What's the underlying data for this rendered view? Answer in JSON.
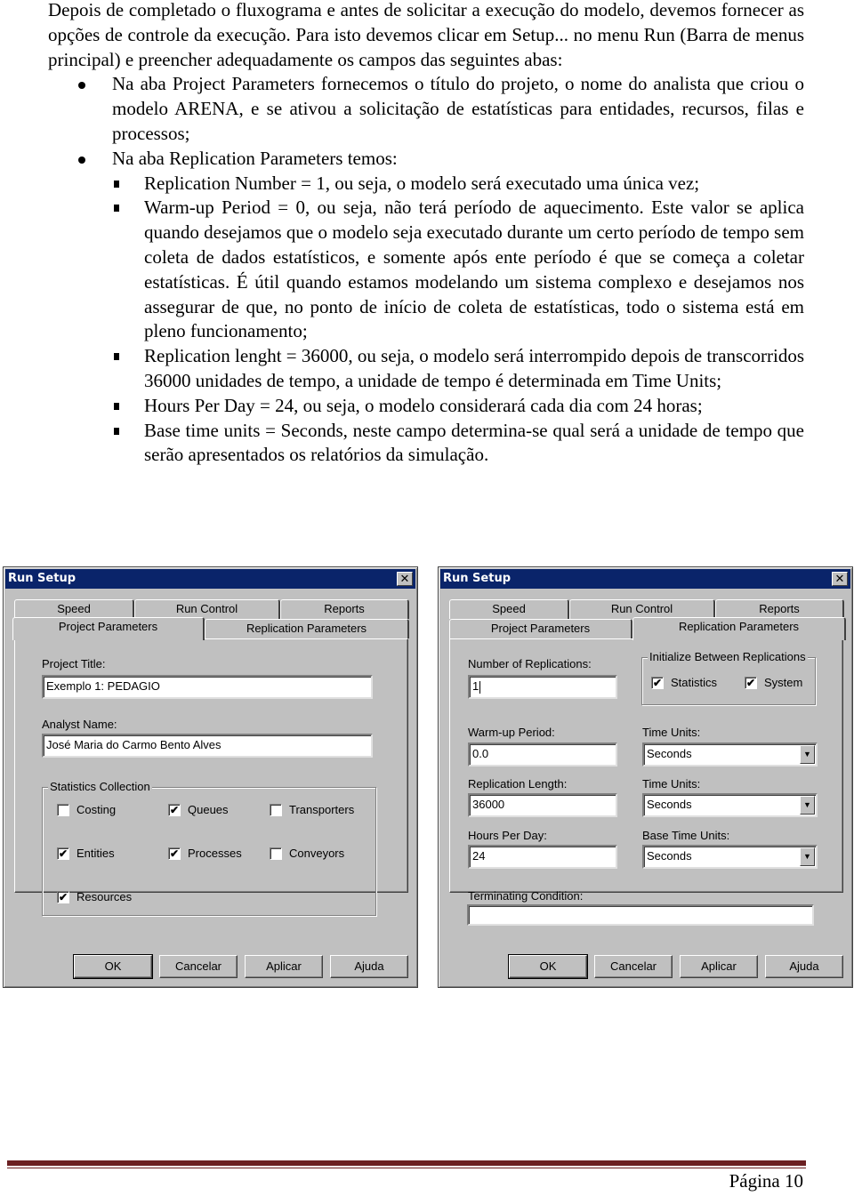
{
  "document": {
    "intro": "Depois de completado o fluxograma e antes de solicitar a execução do modelo, devemos fornecer as opções de controle da execução. Para isto devemos clicar em Setup... no menu Run (Barra de menus principal) e preencher adequadamente os campos das seguintes abas:",
    "bullets": [
      {
        "text": "Na aba Project Parameters fornecemos o título do projeto, o nome do analista que criou o modelo ARENA, e se ativou a solicitação de estatísticas para entidades, recursos, filas e processos;"
      },
      {
        "text": "Na aba Replication Parameters temos:"
      }
    ],
    "sub_bullets": [
      "Replication Number = 1, ou seja, o modelo será executado uma única vez;",
      "Warm-up Period = 0, ou seja, não terá período de aquecimento. Este valor se aplica quando desejamos que o modelo seja executado durante um certo período de tempo sem coleta de dados estatísticos, e somente após ente período é que se começa a coletar estatísticas. É útil quando estamos modelando um sistema complexo e desejamos nos assegurar de que, no ponto de início de coleta de estatísticas, todo o sistema está em pleno funcionamento;",
      "Replication lenght = 36000, ou seja, o modelo será interrompido depois de transcorridos 36000 unidades de tempo, a unidade de tempo é determinada em Time Units;",
      "Hours Per Day = 24, ou seja, o modelo considerará cada dia com 24 horas;",
      "Base time units = Seconds, neste campo determina-se qual será a unidade de tempo que serão apresentados os relatórios da simulação."
    ]
  },
  "dialog_common": {
    "title": "Run Setup",
    "close_glyph": "✕",
    "tabs": {
      "speed": "Speed",
      "run_control": "Run Control",
      "reports": "Reports",
      "project_parameters": "Project Parameters",
      "replication_parameters": "Replication Parameters"
    },
    "buttons": {
      "ok": "OK",
      "cancel": "Cancelar",
      "apply": "Aplicar",
      "help": "Ajuda"
    },
    "check_glyph": "✔",
    "dropdown_glyph": "▼"
  },
  "dialog_project": {
    "active_tab": "Project Parameters",
    "project_title_label": "Project Title:",
    "project_title_value": "Exemplo 1: PEDAGIO",
    "analyst_name_label": "Analyst Name:",
    "analyst_name_value": "José Maria do Carmo Bento Alves",
    "stats_group_label": "Statistics Collection",
    "stats": [
      {
        "label": "Costing",
        "checked": false
      },
      {
        "label": "Queues",
        "checked": true
      },
      {
        "label": "Transporters",
        "checked": false
      },
      {
        "label": "Entities",
        "checked": true
      },
      {
        "label": "Processes",
        "checked": true
      },
      {
        "label": "Conveyors",
        "checked": false
      },
      {
        "label": "Resources",
        "checked": true
      }
    ]
  },
  "dialog_replication": {
    "active_tab": "Replication Parameters",
    "num_replications_label": "Number of Replications:",
    "num_replications_value": "1",
    "init_group_label": "Initialize Between Replications",
    "init_options": [
      {
        "label": "Statistics",
        "checked": true
      },
      {
        "label": "System",
        "checked": true
      }
    ],
    "warmup_label": "Warm-up Period:",
    "warmup_value": "0.0",
    "warmup_units_label": "Time Units:",
    "warmup_units_value": "Seconds",
    "rep_length_label": "Replication Length:",
    "rep_length_value": "36000",
    "rep_length_units_label": "Time Units:",
    "rep_length_units_value": "Seconds",
    "hours_per_day_label": "Hours Per Day:",
    "hours_per_day_value": "24",
    "base_units_label": "Base Time Units:",
    "base_units_value": "Seconds",
    "terminating_label": "Terminating Condition:",
    "terminating_value": ""
  },
  "footer": {
    "page_label": "Página 10",
    "rule_color": "#6b2022"
  }
}
